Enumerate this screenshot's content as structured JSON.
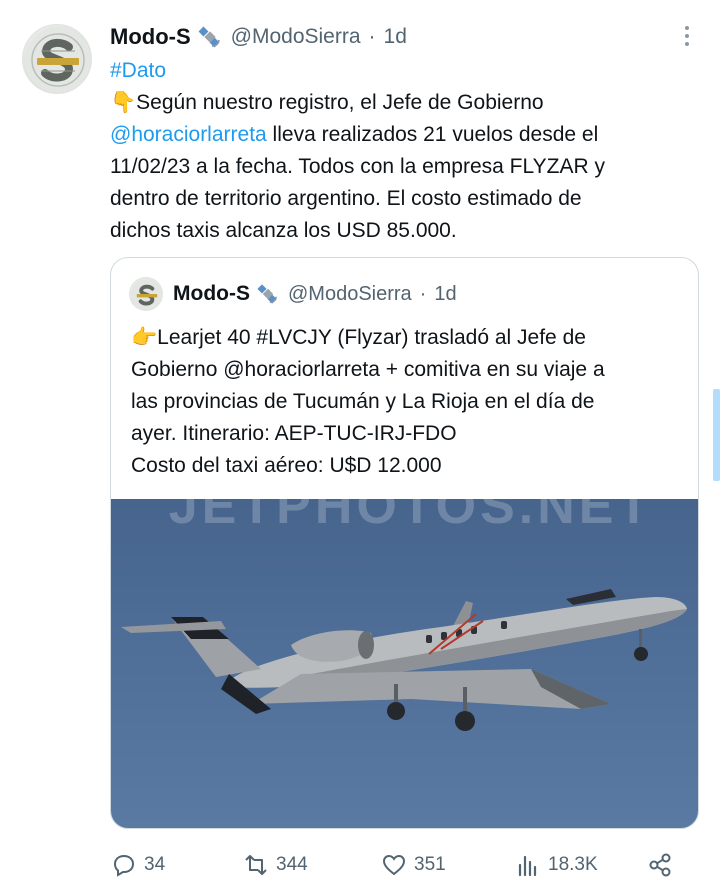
{
  "tweet": {
    "author_name": "Modo-S",
    "author_handle": "@ModoSierra",
    "time_sep": "·",
    "time": "1d",
    "badge_icon": "satellite-icon",
    "text": {
      "hashtag": "#Dato",
      "emoji": "👇",
      "line1": "Según nuestro registro, el Jefe de Gobierno",
      "mention": "@horaciorlarreta",
      "line2_rest": " lleva realizados 21 vuelos desde el",
      "line3": "11/02/23 a la fecha. Todos con la empresa FLYZAR y",
      "line4": "dentro de territorio argentino. El costo estimado de",
      "line5": "dichos taxis alcanza los USD 85.000."
    }
  },
  "quote": {
    "author_name": "Modo-S",
    "author_handle": "@ModoSierra",
    "time_sep": "·",
    "time": "1d",
    "emoji": "👉",
    "line1": "Learjet 40 #LVCJY (Flyzar) trasladó al Jefe de",
    "line2": "Gobierno @horaciorlarreta + comitiva en su viaje a",
    "line3": "las provincias de Tucumán y La Rioja en el día de",
    "line4": "ayer. Itinerario: AEP-TUC-IRJ-FDO",
    "line5": "Costo del taxi aéreo: U$D 12.000",
    "photo_watermark": "JETPHOTOS.NET"
  },
  "actions": {
    "replies": "34",
    "retweets": "344",
    "likes": "351",
    "views": "18.3K"
  },
  "colors": {
    "accent": "#1d9bf0",
    "secondary_text": "#536471",
    "border": "#cfd9de"
  }
}
